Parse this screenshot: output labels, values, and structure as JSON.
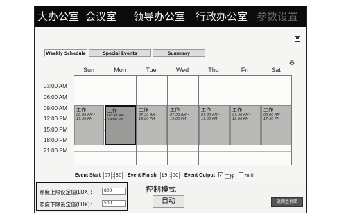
{
  "nav": {
    "items": [
      {
        "label": "大办公室"
      },
      {
        "label": "会议室"
      },
      {
        "label": "领导办公室"
      },
      {
        "label": "行政办公室"
      },
      {
        "label": "参数设置"
      }
    ]
  },
  "tabs": [
    {
      "label": "Weekly Schedule",
      "active": true
    },
    {
      "label": "Special Events",
      "active": false
    },
    {
      "label": "Summary",
      "active": false
    }
  ],
  "icons": {
    "save": "save-icon",
    "settings": "gear-icon"
  },
  "schedule": {
    "days": [
      "Sun",
      "Mon",
      "Tue",
      "Wed",
      "Thu",
      "Fri",
      "Sat"
    ],
    "times": [
      "03:00 AM",
      "06:00 AM",
      "09:00 AM",
      "12:00 PM",
      "15:00 PM",
      "18:00 PM",
      "21:00 PM"
    ],
    "events": [
      {
        "title": "工作",
        "start": "08:00 AM -",
        "end": "17:30 PM"
      },
      {
        "title": "工作",
        "start": "07:30 AM -",
        "end": "19:00 PM"
      },
      {
        "title": "工作",
        "start": "07:30 AM -",
        "end": "19:00 PM"
      },
      {
        "title": "工作",
        "start": "07:30 AM -",
        "end": "19:00 PM"
      },
      {
        "title": "工作",
        "start": "07:30 AM -",
        "end": "19:00 PM"
      },
      {
        "title": "工作",
        "start": "07:30 AM -",
        "end": "19:00 PM"
      },
      {
        "title": "工作",
        "start": "08:00 AM -",
        "end": "17:30 PM"
      }
    ]
  },
  "event_settings": {
    "start_label": "Event Start",
    "start_hour": "07",
    "start_minute": "30",
    "finish_label": "Event Finish",
    "finish_hour": "19",
    "finish_minute": "00",
    "output_label": "Event Output",
    "option_work": "工作",
    "option_work_checked": true,
    "option_null": "null",
    "option_null_checked": false,
    "separator": ":"
  },
  "lux": {
    "upper_label": "照度上限设定值(LUX)：",
    "upper_value": "800",
    "lower_label": "照度下限设定值(LUX)：",
    "lower_value": "500"
  },
  "control": {
    "mode_title": "控制模式",
    "mode_value": "自动",
    "return_label": "返回主界面"
  },
  "colors": {
    "nav_bg": "#0b0b0b",
    "event_fill": "#b9b9b7",
    "nav_disabled": "#6a6a6a"
  }
}
